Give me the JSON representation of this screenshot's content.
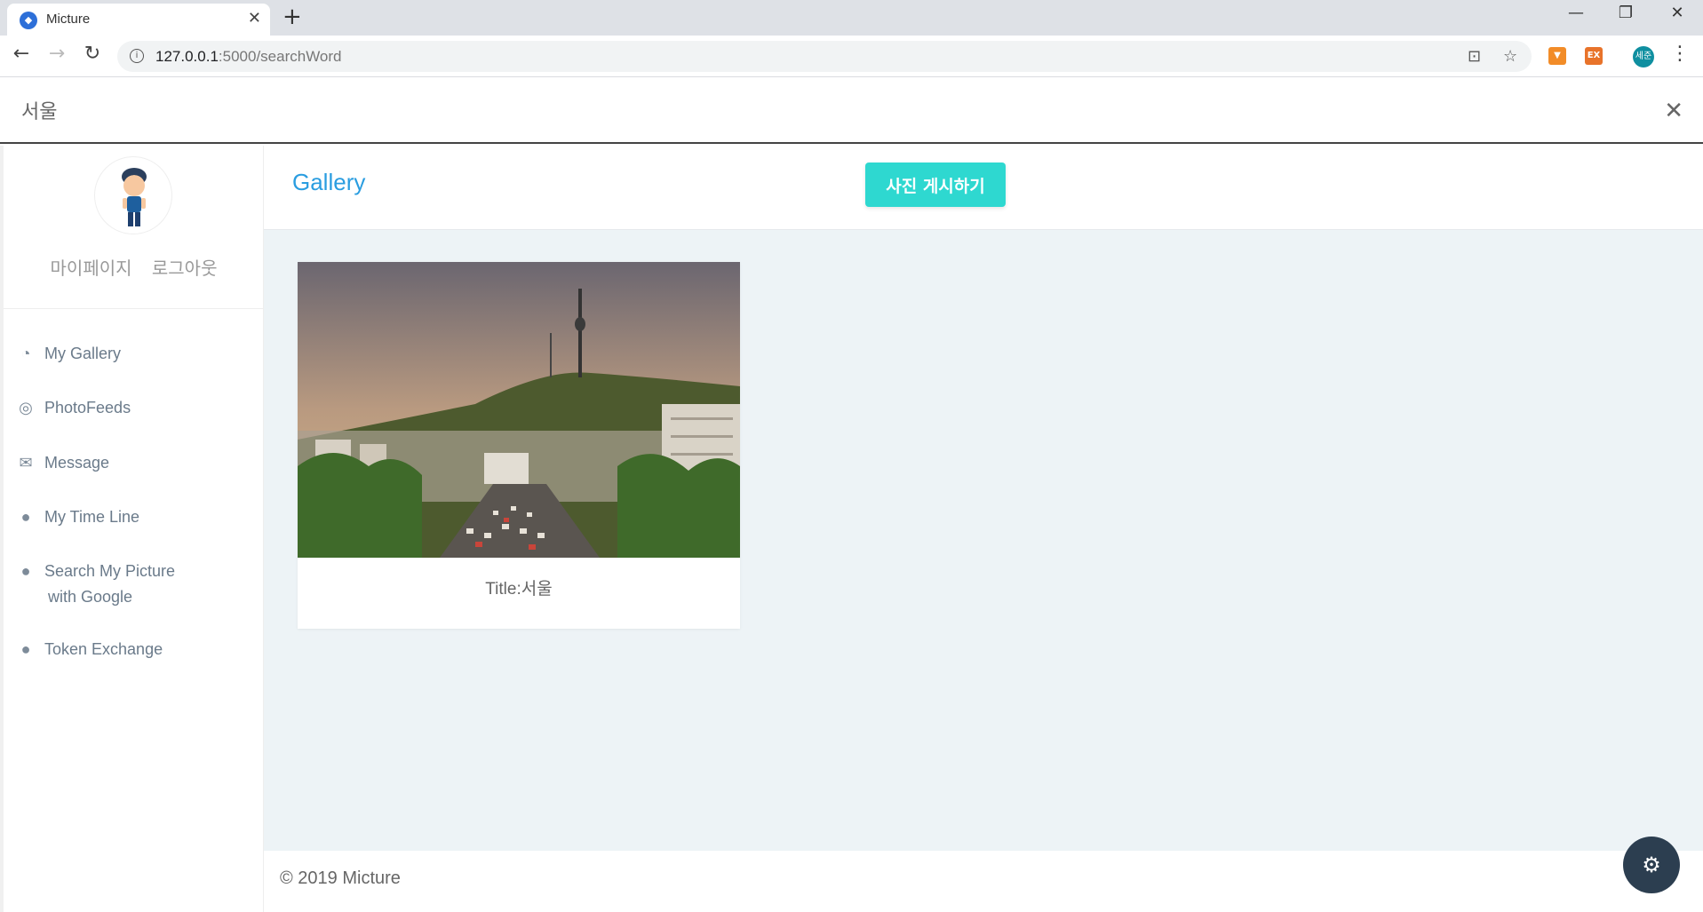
{
  "browser": {
    "tab_title": "Micture",
    "url_host": "127.0.0.1",
    "url_path": ":5000/searchWord",
    "profile_initials": "세준",
    "extension_label": "EX"
  },
  "search": {
    "query": "서울"
  },
  "sidebar": {
    "profile_links": [
      "마이페이지",
      "로그아웃"
    ],
    "items": [
      {
        "label": "My Gallery",
        "icon": "dashboard-icon"
      },
      {
        "label": "PhotoFeeds",
        "icon": "target-icon"
      },
      {
        "label": "Message",
        "icon": "mail-icon"
      },
      {
        "label": "My Time Line",
        "icon": "bubbles-icon"
      },
      {
        "label": "Search My Picture",
        "label2": "with Google",
        "icon": "bubbles-icon"
      },
      {
        "label": "Token Exchange",
        "icon": "bubbles-icon"
      }
    ]
  },
  "main": {
    "title": "Gallery",
    "post_button": "사진 게시하기",
    "cards": [
      {
        "caption": "Title:서울"
      }
    ]
  },
  "footer": {
    "text": "© 2019 Micture"
  },
  "colors": {
    "accent_blue": "#2a9de0",
    "button_teal": "#2ed8d0",
    "content_bg": "#edf3f6",
    "fab_dark": "#2c3e50"
  }
}
